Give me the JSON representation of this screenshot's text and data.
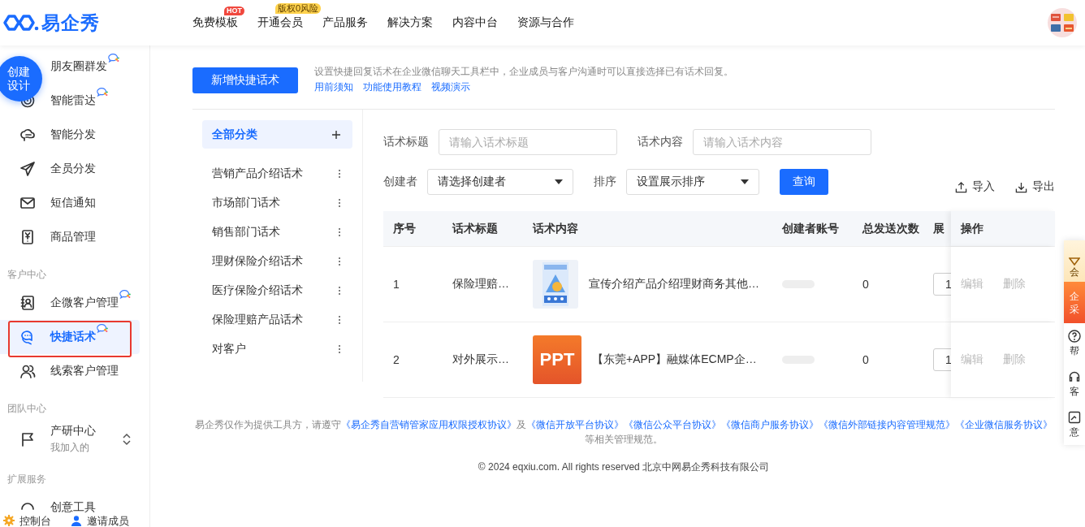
{
  "header": {
    "logo": "易企秀",
    "nav": [
      {
        "label": "免费模板",
        "badge": "HOT"
      },
      {
        "label": "开通会员",
        "badge": "版权0风险"
      },
      {
        "label": "产品服务"
      },
      {
        "label": "解决方案"
      },
      {
        "label": "内容中台"
      },
      {
        "label": "资源与合作"
      }
    ]
  },
  "create_button": [
    "创建",
    "设计"
  ],
  "sidebar": {
    "sections": [
      {
        "items": [
          {
            "label": "朋友圈群发",
            "new": true,
            "selected": false,
            "highlighted": false
          },
          {
            "label": "智能雷达",
            "new": true,
            "selected": false,
            "highlighted": false
          },
          {
            "label": "智能分发",
            "new": false,
            "selected": false,
            "highlighted": false
          },
          {
            "label": "全员分发",
            "new": false,
            "selected": false,
            "highlighted": false
          },
          {
            "label": "短信通知",
            "new": false,
            "selected": false,
            "highlighted": false
          },
          {
            "label": "商品管理",
            "new": false,
            "selected": false,
            "highlighted": false
          }
        ]
      },
      {
        "title": "客户中心",
        "items": [
          {
            "label": "企微客户管理",
            "new": true,
            "selected": false,
            "highlighted": false
          },
          {
            "label": "快捷话术",
            "new": true,
            "selected": true,
            "highlighted": true
          },
          {
            "label": "线索客户管理",
            "new": false,
            "selected": false,
            "highlighted": false
          }
        ]
      },
      {
        "title": "团队中心",
        "items": [
          {
            "label": "产研中心",
            "sub": "我加入的",
            "new": false,
            "selected": false,
            "highlighted": false,
            "switcher": true
          }
        ]
      },
      {
        "title": "扩展服务",
        "items": [
          {
            "label": "创意工具",
            "new": false,
            "selected": false,
            "highlighted": false
          }
        ]
      }
    ],
    "bottom": [
      {
        "label": "控制台"
      },
      {
        "label": "邀请成员"
      }
    ]
  },
  "toolbar": {
    "add_button": "新增快捷话术",
    "description": "设置快捷回复话术在企业微信聊天工具栏中，企业成员与客户沟通时可以直接选择已有话术回复。",
    "links": [
      "用前须知",
      "功能使用教程",
      "视频演示"
    ]
  },
  "categories": [
    {
      "label": "全部分类",
      "selected": true
    },
    {
      "label": "营销产品介绍话术",
      "selected": false
    },
    {
      "label": "市场部门话术",
      "selected": false
    },
    {
      "label": "销售部门话术",
      "selected": false
    },
    {
      "label": "理财保险介绍话术",
      "selected": false
    },
    {
      "label": "医疗保险介绍话术",
      "selected": false
    },
    {
      "label": "保险理赔产品话术",
      "selected": false
    },
    {
      "label": "对客户",
      "selected": false
    }
  ],
  "filters": [
    {
      "label": "话术标题",
      "kind": "input",
      "placeholder": "请输入话术标题"
    },
    {
      "label": "话术内容",
      "kind": "input",
      "placeholder": "请输入话术内容"
    },
    {
      "label": "创建者",
      "kind": "select",
      "value": "请选择创建者"
    },
    {
      "label": "排序",
      "kind": "select",
      "value": "设置展示排序"
    }
  ],
  "query_button": "查询",
  "actions": [
    {
      "label": "导入"
    },
    {
      "label": "导出"
    }
  ],
  "table": {
    "columns": [
      "序号",
      "话术标题",
      "话术内容",
      "创建者账号",
      "总发送次数",
      "展",
      "操作"
    ],
    "rows": [
      {
        "index": "1",
        "title": "保险理赔…",
        "thumb": {
          "kind": "picture"
        },
        "content": "宣传介绍产品介绍理财商务其他…",
        "sends": "0",
        "order": "1",
        "actions": [
          {
            "label": "编辑",
            "disabled": true
          },
          {
            "label": "删除",
            "disabled": true
          }
        ]
      },
      {
        "index": "2",
        "title": "对外展示…",
        "thumb": {
          "kind": "ppt",
          "text": "PPT"
        },
        "content": "【东莞+APP】融媒体ECMP企…",
        "sends": "0",
        "order": "1",
        "actions": [
          {
            "label": "编辑",
            "disabled": true
          },
          {
            "label": "删除",
            "disabled": true
          }
        ]
      }
    ]
  },
  "footer": {
    "notice": "易企秀仅作为提供工具方，请遵守",
    "agreements": [
      "《易企秀自营销管家应用权限授权协议》",
      "《微信开放平台协议》",
      "《微信公众平台协议》",
      "《微信商户服务协议》",
      "《微信外部链接内容管理规范》",
      "《企业微信服务协议》"
    ],
    "joiner": "及",
    "tail": "等相关管理规范。",
    "copyright": "© 2024 eqxiu.com. All rights reserved 北京中网易企秀科技有限公司"
  },
  "side_panel": [
    {
      "lines": [
        "会"
      ],
      "kind": "vip"
    },
    {
      "lines": [
        "企",
        "采"
      ],
      "kind": "enterprise"
    },
    {
      "lines": [
        "帮"
      ],
      "kind": "help"
    },
    {
      "lines": [
        "客"
      ],
      "kind": "service"
    },
    {
      "lines": [
        "意"
      ],
      "kind": "feedback"
    }
  ]
}
